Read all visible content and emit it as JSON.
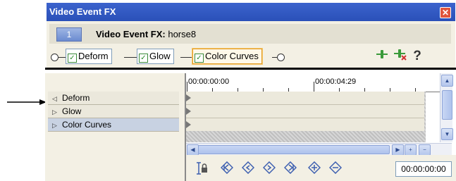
{
  "fx_window": {
    "title": "Video Event FX",
    "close_symbol": "✕",
    "event_number": "1",
    "event_label_prefix": "Video Event FX:",
    "event_name": " horse8",
    "chain": [
      {
        "label": "Deform",
        "checked": true
      },
      {
        "label": "Glow",
        "checked": true
      },
      {
        "label": "Color Curves",
        "checked": true,
        "selected": true
      }
    ],
    "check_mark": "✓",
    "toolbar_icons": [
      "plug-in-chain-icon",
      "remove-plug-in-icon",
      "help-icon"
    ],
    "help_symbol": "?"
  },
  "keyframe_panel": {
    "fx_list": [
      {
        "label": "Deform",
        "expanded": true
      },
      {
        "label": "Glow",
        "expanded": false
      },
      {
        "label": "Color Curves",
        "expanded": false,
        "selected": true
      }
    ],
    "ruler": {
      "time_start": "00:00:00:00",
      "time_mid": "00:00:04:29"
    },
    "cursor_timecode": "00:00:00:00",
    "transport_icons": [
      "lock-envelope-icon",
      "first-keyframe-icon",
      "previous-keyframe-icon",
      "next-keyframe-icon",
      "last-keyframe-icon",
      "add-keyframe-icon",
      "delete-keyframe-icon"
    ]
  },
  "colors": {
    "titlebar": "#2a50b8",
    "selected_fx_border": "#e09a24",
    "transport_icons": "#3d5fb0"
  }
}
